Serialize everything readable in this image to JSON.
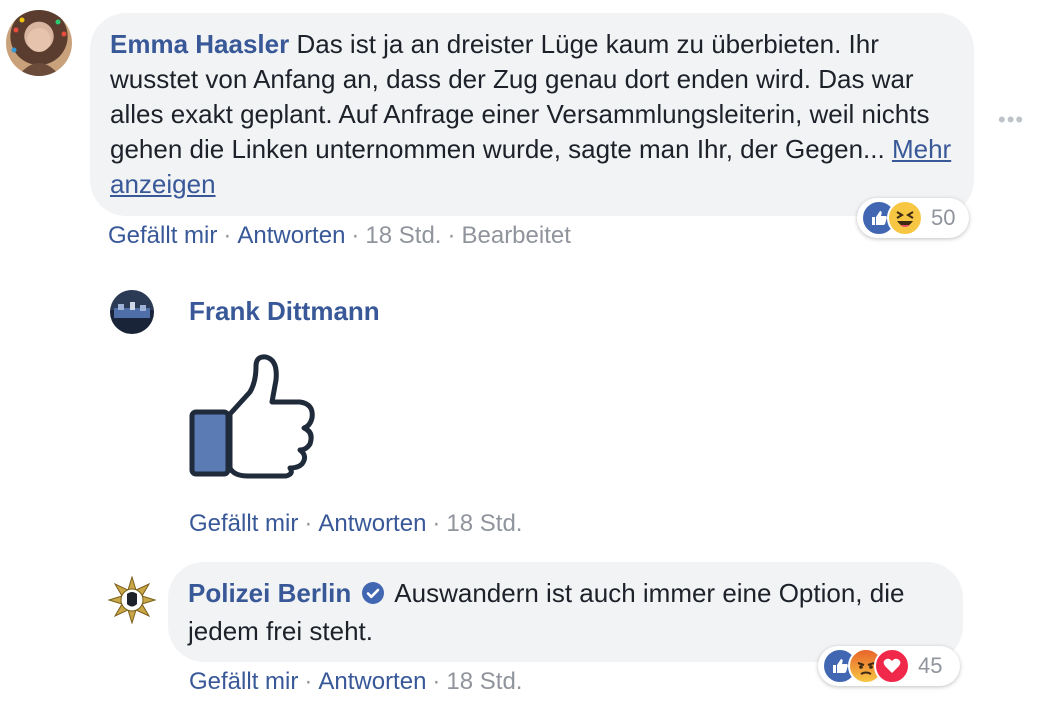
{
  "comments": [
    {
      "author": "Emma Haasler",
      "text": "Das ist ja an dreister Lüge kaum zu überbieten. Ihr wusstet von Anfang an, dass der Zug genau dort enden wird. Das war alles exakt geplant. Auf Anfrage einer Versammlungsleiterin, weil nichts gehen die Linken unternommen wurde, sagte man Ihr, der Gegen...",
      "see_more": "Mehr anzeigen",
      "like": "Gefällt mir",
      "reply": "Antworten",
      "time": "18 Std.",
      "edited": "Bearbeitet",
      "reaction_count": "50",
      "reaction_icons": [
        "like-icon",
        "haha-icon"
      ]
    },
    {
      "author": "Frank Dittmann",
      "sticker": "thumbs-up-sticker",
      "like": "Gefällt mir",
      "reply": "Antworten",
      "time": "18 Std."
    },
    {
      "author": "Polizei Berlin",
      "verified": true,
      "text": "Auswandern ist auch immer eine Option, die jedem frei steht.",
      "like": "Gefällt mir",
      "reply": "Antworten",
      "time": "18 Std.",
      "reaction_count": "45",
      "reaction_icons": [
        "like-icon",
        "angry-icon",
        "love-icon"
      ]
    }
  ],
  "colors": {
    "link": "#385898",
    "bubble": "#f2f3f5",
    "meta": "#90949c",
    "like_blue": "#4267b2",
    "angry": "#f0892c",
    "love": "#f0284a",
    "haha": "#f7c744"
  }
}
